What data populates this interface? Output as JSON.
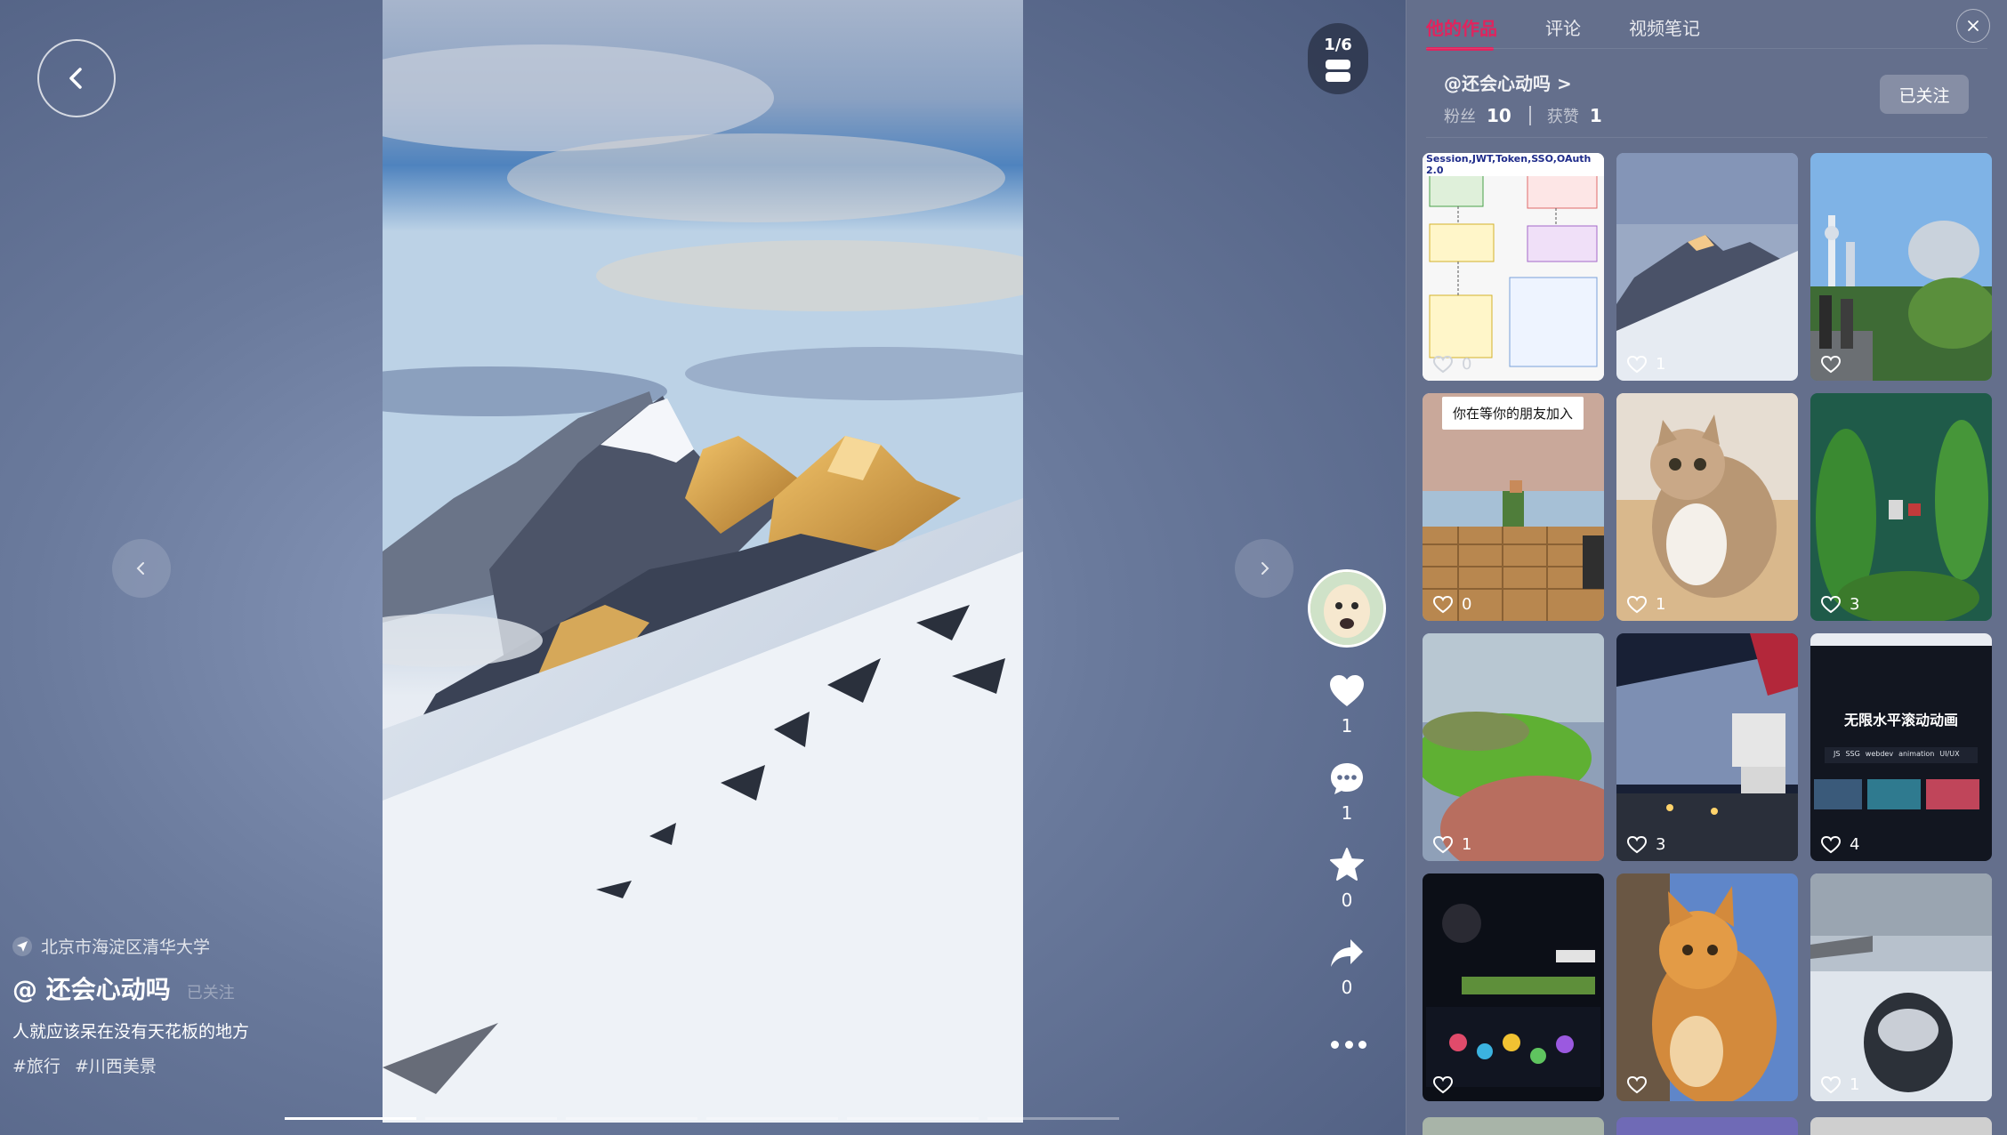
{
  "player": {
    "counter": "1/6",
    "location": "北京市海淀区清华大学",
    "author": "@ 还会心动吗",
    "follow_status": "已关注",
    "description": "人就应该呆在没有天花板的地方",
    "tags": [
      "#旅行",
      "#川西美景"
    ],
    "actions": {
      "likes": "1",
      "comments": "1",
      "favorites": "0",
      "shares": "0"
    },
    "progress": {
      "total_segments": 6,
      "current_segment": 1
    }
  },
  "panel": {
    "tabs": [
      "他的作品",
      "评论",
      "视频笔记"
    ],
    "active_tab": "他的作品",
    "profile": {
      "name": "@还会心动吗 >",
      "fans_label": "粉丝",
      "fans": "10",
      "likes_label": "获赞",
      "likes": "1"
    },
    "follow_button": "已关注",
    "works": [
      {
        "likes": "0",
        "kind": "diagram",
        "title": "Session,JWT,Token,SSO,OAuth 2.0"
      },
      {
        "likes": "1",
        "kind": "mountain"
      },
      {
        "likes": "",
        "kind": "city"
      },
      {
        "likes": "0",
        "kind": "game-block",
        "overlay": "你在等你的朋友加入"
      },
      {
        "likes": "1",
        "kind": "cat"
      },
      {
        "likes": "3",
        "kind": "underwater"
      },
      {
        "likes": "1",
        "kind": "blur"
      },
      {
        "likes": "3",
        "kind": "airplane"
      },
      {
        "likes": "4",
        "kind": "web",
        "title": "无限水平滚动动画",
        "chips": [
          "JS",
          "SSG",
          "webdev",
          "animation",
          "UI/UX"
        ]
      },
      {
        "likes": "",
        "kind": "screen"
      },
      {
        "likes": "",
        "kind": "orange-cat"
      },
      {
        "likes": "1",
        "kind": "car"
      }
    ]
  },
  "colors": {
    "accent": "#e0245e",
    "panel_bg": "#646f8c"
  }
}
